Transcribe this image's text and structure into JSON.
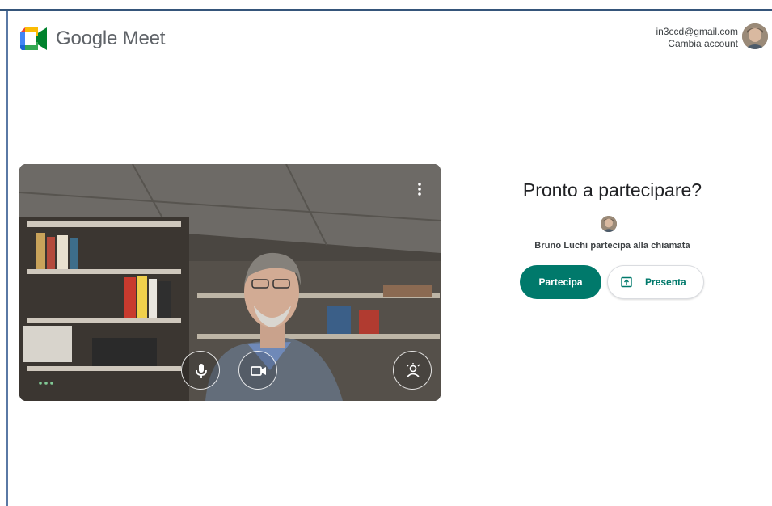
{
  "header": {
    "product_name": "Google Meet",
    "account_email": "in3ccd@gmail.com",
    "switch_account": "Cambia account"
  },
  "preview": {
    "controls": [
      {
        "name": "microphone-icon",
        "label": "Microphone"
      },
      {
        "name": "camera-icon",
        "label": "Camera"
      },
      {
        "name": "visual-effects-icon",
        "label": "Visual effects"
      }
    ],
    "menu_icon": "more-vert-icon"
  },
  "join": {
    "title": "Pronto a partecipare?",
    "participant_text": "Bruno Luchi partecipa alla chiamata",
    "join_label": "Partecipa",
    "present_label": "Presenta"
  },
  "colors": {
    "accent": "#00796b",
    "text": "#202124",
    "border": "#35557a"
  }
}
